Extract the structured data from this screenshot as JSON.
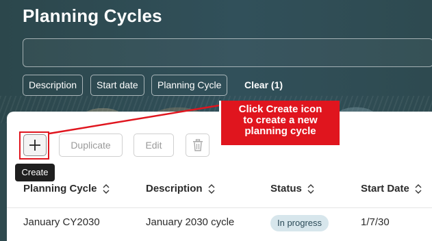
{
  "header": {
    "title": "Planning Cycles",
    "search_placeholder": "",
    "filters": [
      "Description",
      "Start date",
      "Planning Cycle"
    ],
    "clear_label": "Clear (1)"
  },
  "toolbar": {
    "create_icon": "plus-icon",
    "duplicate_label": "Duplicate",
    "edit_label": "Edit",
    "delete_icon": "trash-icon",
    "tooltip": "Create"
  },
  "callout": {
    "lines": [
      "Click Create icon",
      "to create a new",
      "planning cycle"
    ],
    "color": "#e0151e"
  },
  "table": {
    "columns": [
      "Planning Cycle",
      "Description",
      "Status",
      "Start Date"
    ],
    "rows": [
      {
        "planning_cycle": "January CY2030",
        "description": "January 2030 cycle",
        "status": "In progress",
        "start_date": "1/7/30"
      }
    ]
  }
}
